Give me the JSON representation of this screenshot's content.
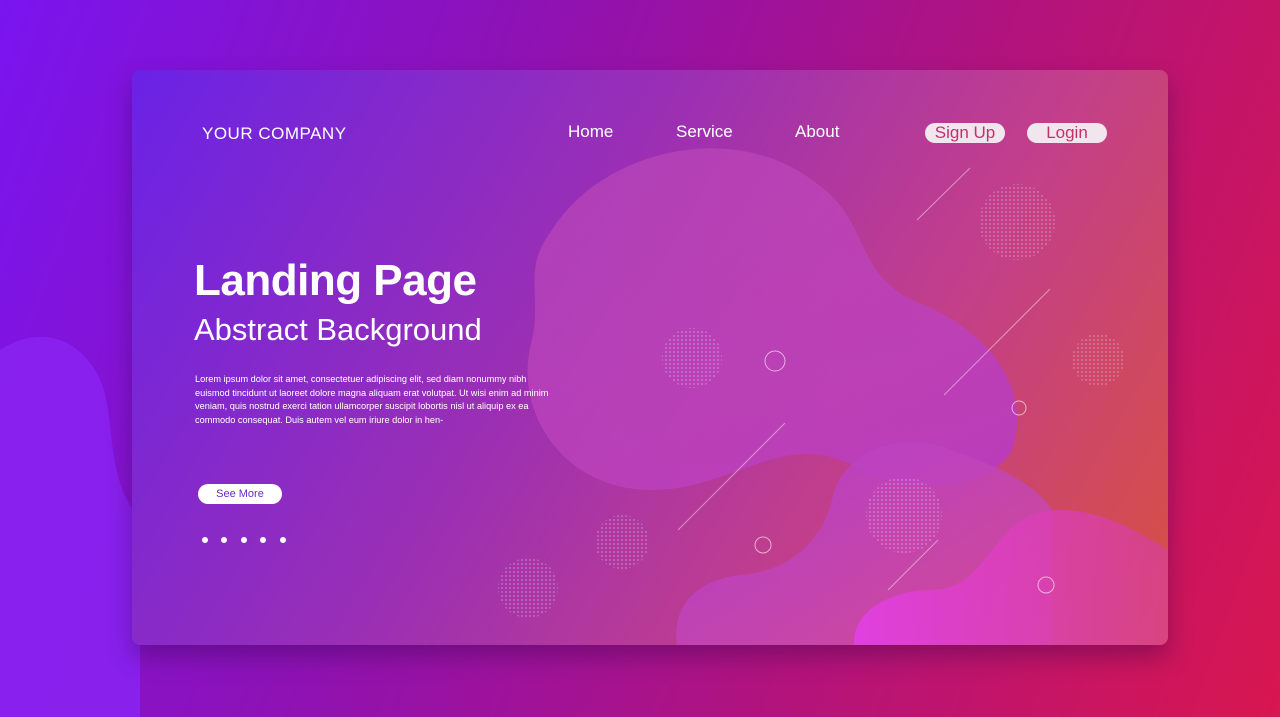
{
  "header": {
    "brand": "YOUR COMPANY",
    "nav": {
      "home": "Home",
      "service": "Service",
      "about": "About"
    },
    "actions": {
      "signup": "Sign Up",
      "login": "Login"
    }
  },
  "hero": {
    "title": "Landing Page",
    "subtitle": "Abstract Background",
    "body": "Lorem ipsum dolor sit amet, consectetuer adipiscing elit, sed diam nonummy nibh euismod tincidunt ut laoreet dolore magna aliquam erat volutpat. Ut wisi enim ad minim veniam, quis nostrud exerci tation ullamcorper suscipit lobortis nisl ut aliquip ex ea commodo consequat. Duis autem vel eum iriure dolor in hen-",
    "cta": "See More"
  },
  "colors": {
    "accent": "#c4306a",
    "cta_text": "#6b28c8"
  }
}
